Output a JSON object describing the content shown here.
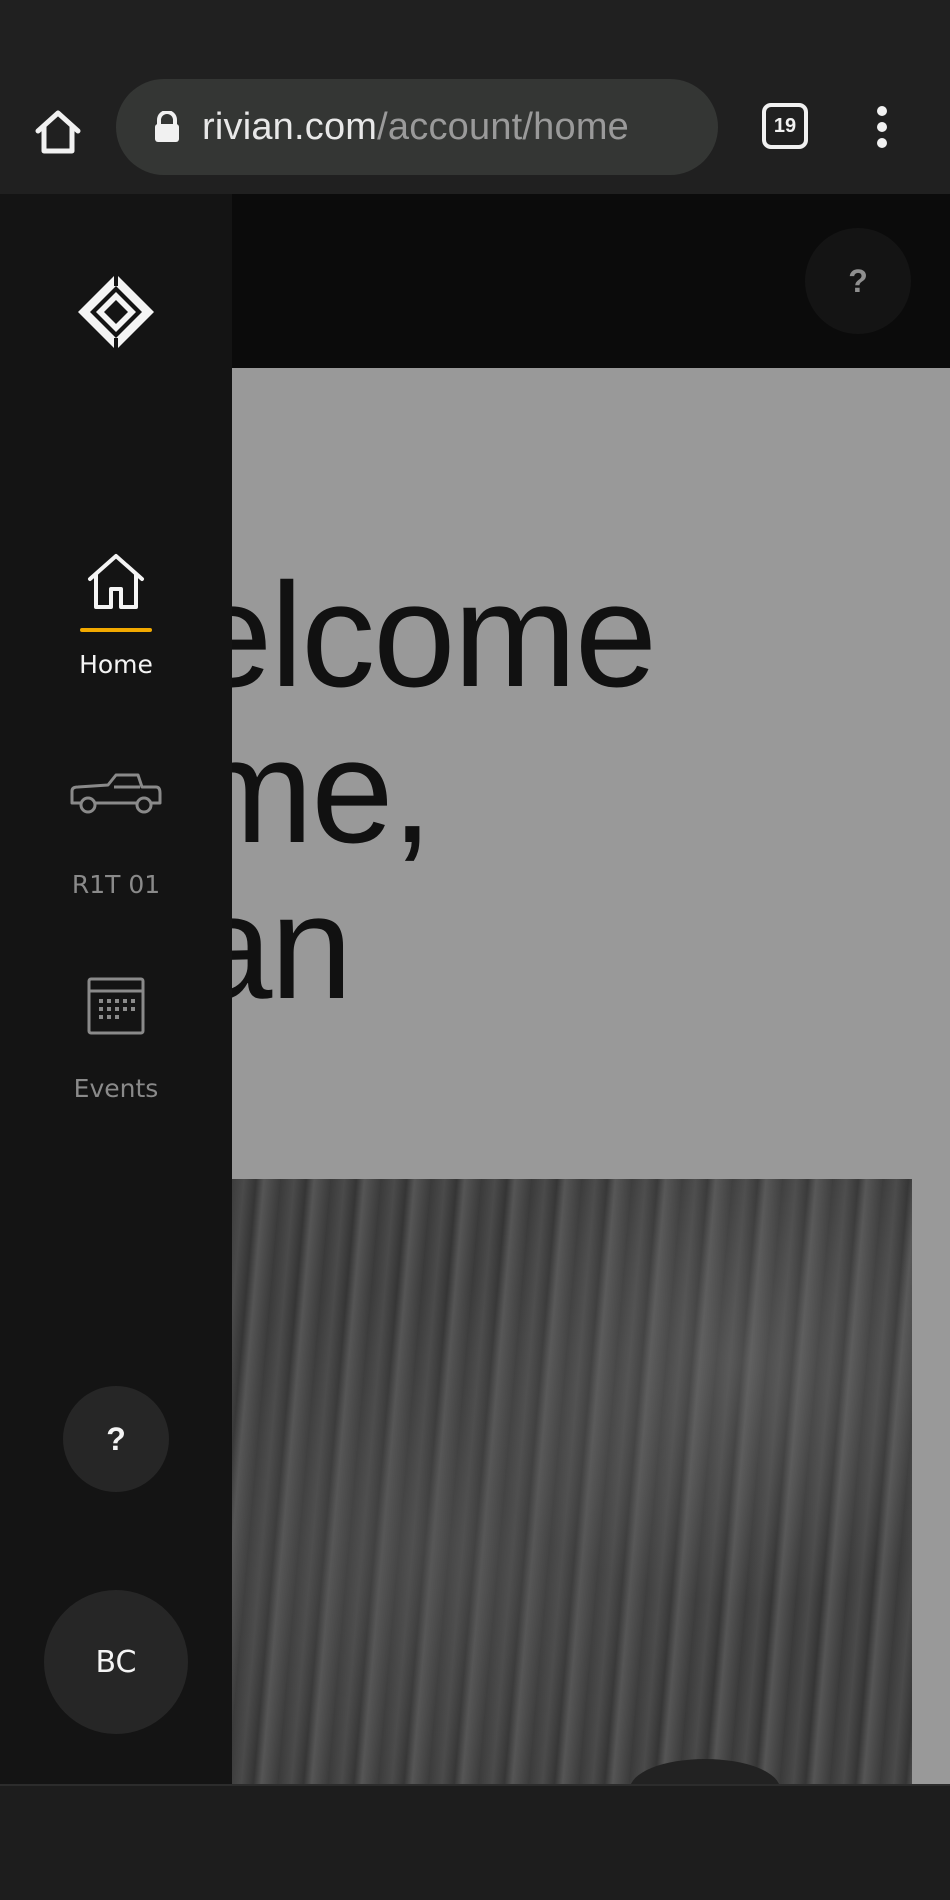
{
  "browser": {
    "url_host": "rivian.com",
    "url_path": "/account/home",
    "tab_count": "19"
  },
  "header": {
    "help_label": "?"
  },
  "main": {
    "welcome_text": "elcome\nme,\nan"
  },
  "sidebar": {
    "items": [
      {
        "label": "Home",
        "icon": "home-icon",
        "active": true
      },
      {
        "label": "R1T 01",
        "icon": "truck-icon",
        "active": false
      },
      {
        "label": "Events",
        "icon": "calendar-icon",
        "active": false
      }
    ],
    "help_label": "?",
    "avatar_initials": "BC"
  },
  "colors": {
    "accent": "#f2a900",
    "sidebar_bg": "#141414",
    "page_bg": "#999999"
  }
}
